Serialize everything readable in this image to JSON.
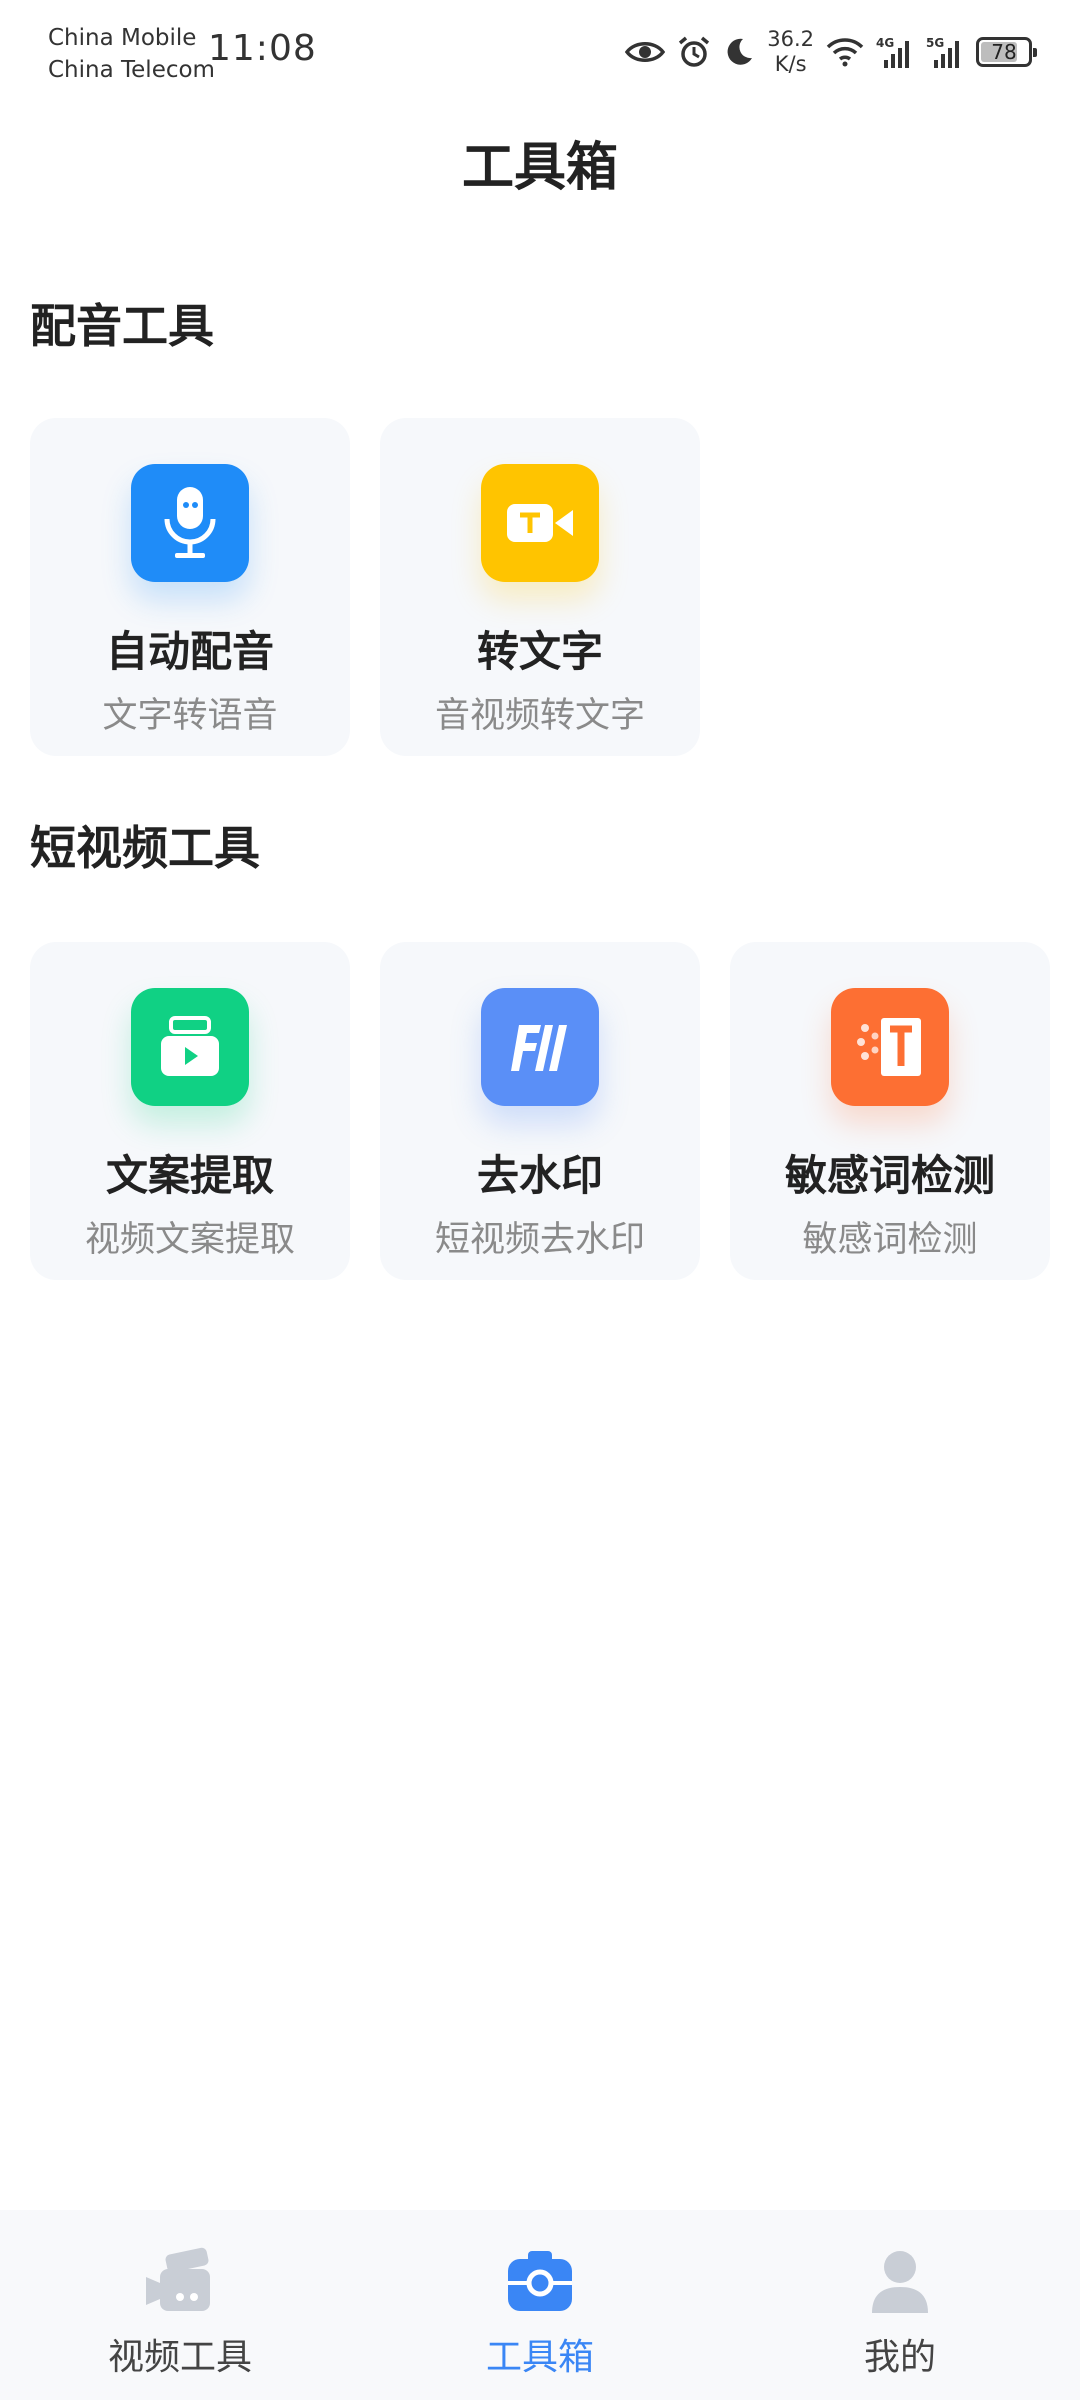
{
  "status": {
    "carrier1": "China Mobile",
    "carrier2": "China Telecom",
    "time": "11:08",
    "speed_value": "36.2",
    "speed_unit": "K/s",
    "net1": "4G",
    "net2": "5G",
    "battery": "78",
    "battery_level": 0.78,
    "icons": [
      "eye-icon",
      "alarm-icon",
      "moon-icon",
      "wifi-icon",
      "signal-icon",
      "signal-icon",
      "battery-icon"
    ]
  },
  "page": {
    "title": "工具箱"
  },
  "sections": [
    {
      "title": "配音工具",
      "tools": [
        {
          "title": "自动配音",
          "subtitle": "文字转语音",
          "icon": "microphone-icon",
          "color": "#1f8cf8"
        },
        {
          "title": "转文字",
          "subtitle": "音视频转文字",
          "icon": "video-text-icon",
          "color": "#ffc400"
        }
      ]
    },
    {
      "title": "短视频工具",
      "tools": [
        {
          "title": "文案提取",
          "subtitle": "视频文案提取",
          "icon": "video-copy-icon",
          "color": "#10d184"
        },
        {
          "title": "去水印",
          "subtitle": "短视频去水印",
          "icon": "watermark-remove-icon",
          "color": "#5a8ff7"
        },
        {
          "title": "敏感词检测",
          "subtitle": "敏感词检测",
          "icon": "sensitive-word-icon",
          "color": "#fd6f33"
        }
      ]
    }
  ],
  "nav": {
    "items": [
      {
        "label": "视频工具",
        "icon": "video-camera-icon",
        "active": false
      },
      {
        "label": "工具箱",
        "icon": "toolbox-icon",
        "active": true
      },
      {
        "label": "我的",
        "icon": "user-icon",
        "active": false
      }
    ],
    "active_color": "#3a86f5",
    "inactive_icon_color": "#c9ced6"
  }
}
